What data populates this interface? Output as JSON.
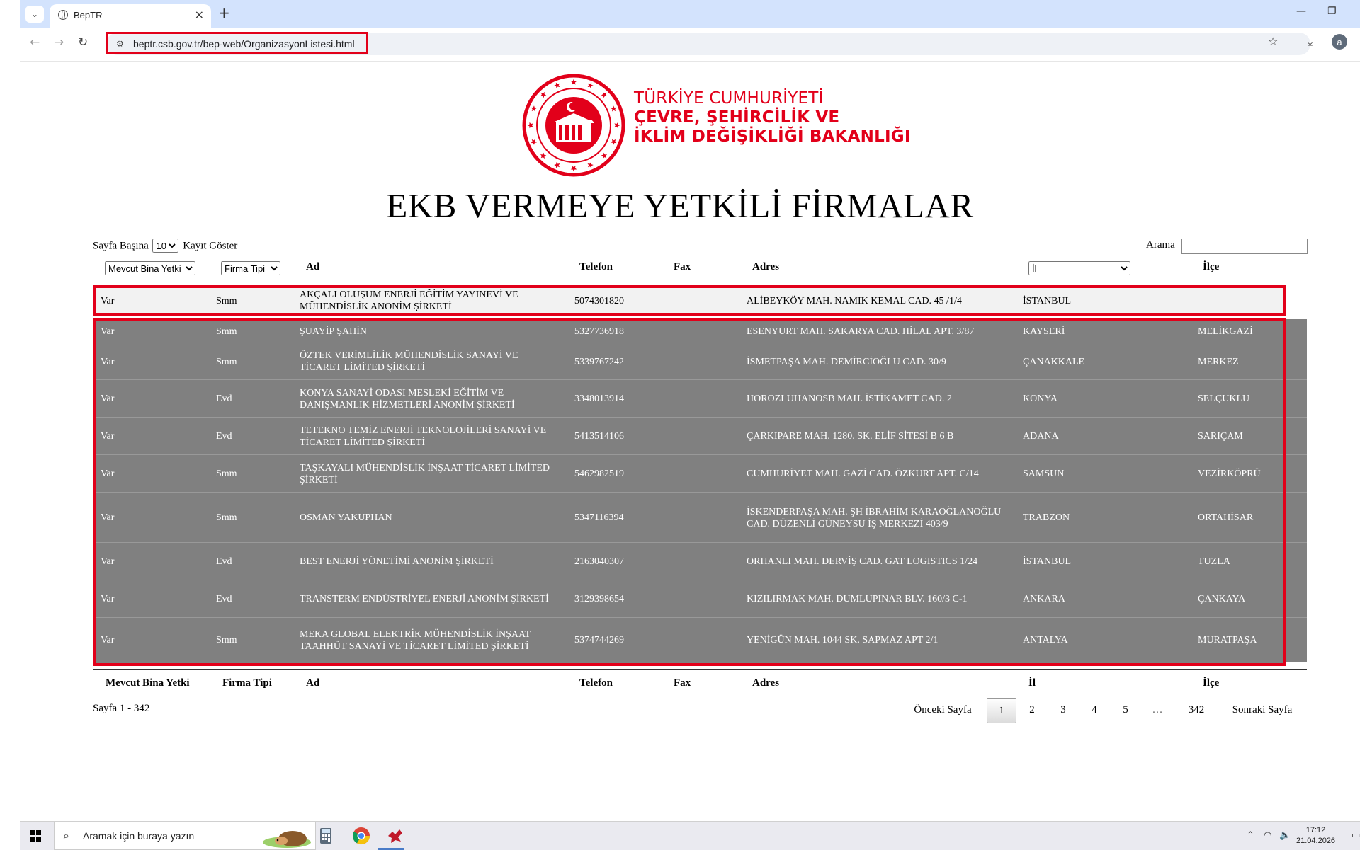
{
  "browser": {
    "tab_title": "BepTR",
    "url": "beptr.csb.gov.tr/bep-web/OrganizasyonListesi.html"
  },
  "brand": {
    "line1": "TÜRKİYE CUMHURİYETİ",
    "line2": "ÇEVRE, ŞEHİRCİLİK VE",
    "line3": "İKLİM DEĞİŞİKLİĞİ BAKANLIĞI",
    "color": "#e2001a"
  },
  "page": {
    "title": "EKB VERMEYE YETKİLİ FİRMALAR",
    "per_page_prefix": "Sayfa Başına",
    "per_page_value": "10",
    "per_page_suffix": "Kayıt Göster",
    "search_label": "Arama",
    "search_value": ""
  },
  "filters": {
    "mevcut": "Mevcut Bina Yetki",
    "firma_tipi": "Firma Tipi",
    "il": "İl"
  },
  "columns": {
    "mevcut": "Mevcut Bina Yetki",
    "firma_tipi": "Firma Tipi",
    "ad": "Ad",
    "telefon": "Telefon",
    "fax": "Fax",
    "adres": "Adres",
    "il": "İl",
    "ilce": "İlçe"
  },
  "rows": [
    {
      "mevcut": "Var",
      "tip": "Smm",
      "ad": "AKÇALI OLUŞUM ENERJİ EĞİTİM YAYINEVİ VE MÜHENDİSLİK ANONİM ŞİRKETİ",
      "telefon": "5074301820",
      "fax": "",
      "adres": "ALİBEYKÖY MAH. NAMIK KEMAL CAD. 45 /1/4",
      "il": "İSTANBUL",
      "ilce": ""
    },
    {
      "mevcut": "Var",
      "tip": "Smm",
      "ad": "ŞUAYİP ŞAHİN",
      "telefon": "5327736918",
      "fax": "",
      "adres": "ESENYURT MAH. SAKARYA CAD. HİLAL APT. 3/87",
      "il": "KAYSERİ",
      "ilce": "MELİKGAZİ"
    },
    {
      "mevcut": "Var",
      "tip": "Smm",
      "ad": "ÖZTEK VERİMLİLİK MÜHENDİSLİK SANAYİ VE TİCARET LİMİTED ŞİRKETİ",
      "telefon": "5339767242",
      "fax": "",
      "adres": "İSMETPAŞA MAH. DEMİRCİOĞLU CAD. 30/9",
      "il": "ÇANAKKALE",
      "ilce": "MERKEZ"
    },
    {
      "mevcut": "Var",
      "tip": "Evd",
      "ad": "KONYA SANAYİ ODASI MESLEKİ EĞİTİM VE DANIŞMANLIK HİZMETLERİ ANONİM ŞİRKETİ",
      "telefon": "3348013914",
      "fax": "",
      "adres": "HOROZLUHANOSB MAH. İSTİKAMET CAD. 2",
      "il": "KONYA",
      "ilce": "SELÇUKLU"
    },
    {
      "mevcut": "Var",
      "tip": "Evd",
      "ad": "TETEKNO TEMİZ ENERJİ TEKNOLOJİLERİ SANAYİ VE TİCARET LİMİTED ŞİRKETİ",
      "telefon": "5413514106",
      "fax": "",
      "adres": "ÇARKIPARE MAH. 1280. SK. ELİF SİTESİ B 6 B",
      "il": "ADANA",
      "ilce": "SARIÇAM"
    },
    {
      "mevcut": "Var",
      "tip": "Smm",
      "ad": "TAŞKAYALI MÜHENDİSLİK İNŞAAT TİCARET LİMİTED ŞİRKETİ",
      "telefon": "5462982519",
      "fax": "",
      "adres": "CUMHURİYET MAH. GAZİ CAD. ÖZKURT APT. C/14",
      "il": "SAMSUN",
      "ilce": "VEZİRKÖPRÜ"
    },
    {
      "mevcut": "Var",
      "tip": "Smm",
      "ad": "OSMAN YAKUPHAN",
      "telefon": "5347116394",
      "fax": "",
      "adres": "İSKENDERPAŞA MAH. ŞH İBRAHİM KARAOĞLANOĞLU CAD. DÜZENLİ GÜNEYSU İŞ MERKEZİ 403/9",
      "il": "TRABZON",
      "ilce": "ORTAHİSAR"
    },
    {
      "mevcut": "Var",
      "tip": "Evd",
      "ad": "BEST ENERJİ YÖNETİMİ ANONİM ŞİRKETİ",
      "telefon": "2163040307",
      "fax": "",
      "adres": "ORHANLI MAH. DERVİŞ CAD. GAT LOGISTICS 1/24",
      "il": "İSTANBUL",
      "ilce": "TUZLA"
    },
    {
      "mevcut": "Var",
      "tip": "Evd",
      "ad": "TRANSTERM ENDÜSTRİYEL ENERJİ ANONİM ŞİRKETİ",
      "telefon": "3129398654",
      "fax": "",
      "adres": "KIZILIRMAK MAH. DUMLUPINAR BLV. 160/3 C-1",
      "il": "ANKARA",
      "ilce": "ÇANKAYA"
    },
    {
      "mevcut": "Var",
      "tip": "Smm",
      "ad": "MEKA GLOBAL ELEKTRİK MÜHENDİSLİK İNŞAAT TAAHHÜT SANAYİ VE TİCARET LİMİTED ŞİRKETİ",
      "telefon": "5374744269",
      "fax": "",
      "adres": "YENİGÜN MAH. 1044 SK. SAPMAZ APT 2/1",
      "il": "ANTALYA",
      "ilce": "MURATPAŞA"
    }
  ],
  "pagination": {
    "info": "Sayfa 1 - 342",
    "prev": "Önceki Sayfa",
    "pages": [
      "1",
      "2",
      "3",
      "4",
      "5",
      "…",
      "342"
    ],
    "current": "1",
    "next": "Sonraki Sayfa"
  },
  "taskbar": {
    "search_placeholder": "Aramak için buraya yazın",
    "time": "17:12",
    "date": "21.04.2026"
  }
}
